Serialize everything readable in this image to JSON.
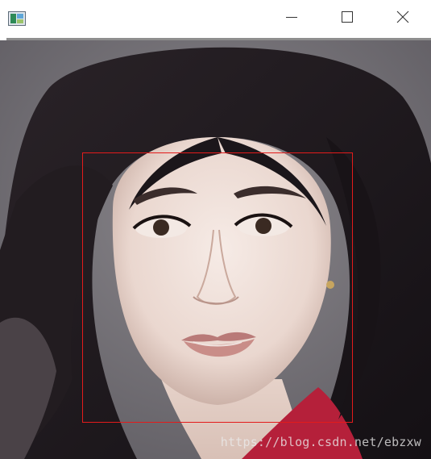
{
  "window": {
    "icons": {
      "app": "app-image-icon",
      "minimize": "minimize-icon",
      "maximize": "maximize-icon",
      "close": "close-icon"
    }
  },
  "content": {
    "image": "portrait-photo",
    "detection_box_color": "#e31b1b",
    "watermark": "https://blog.csdn.net/ebzxw"
  }
}
